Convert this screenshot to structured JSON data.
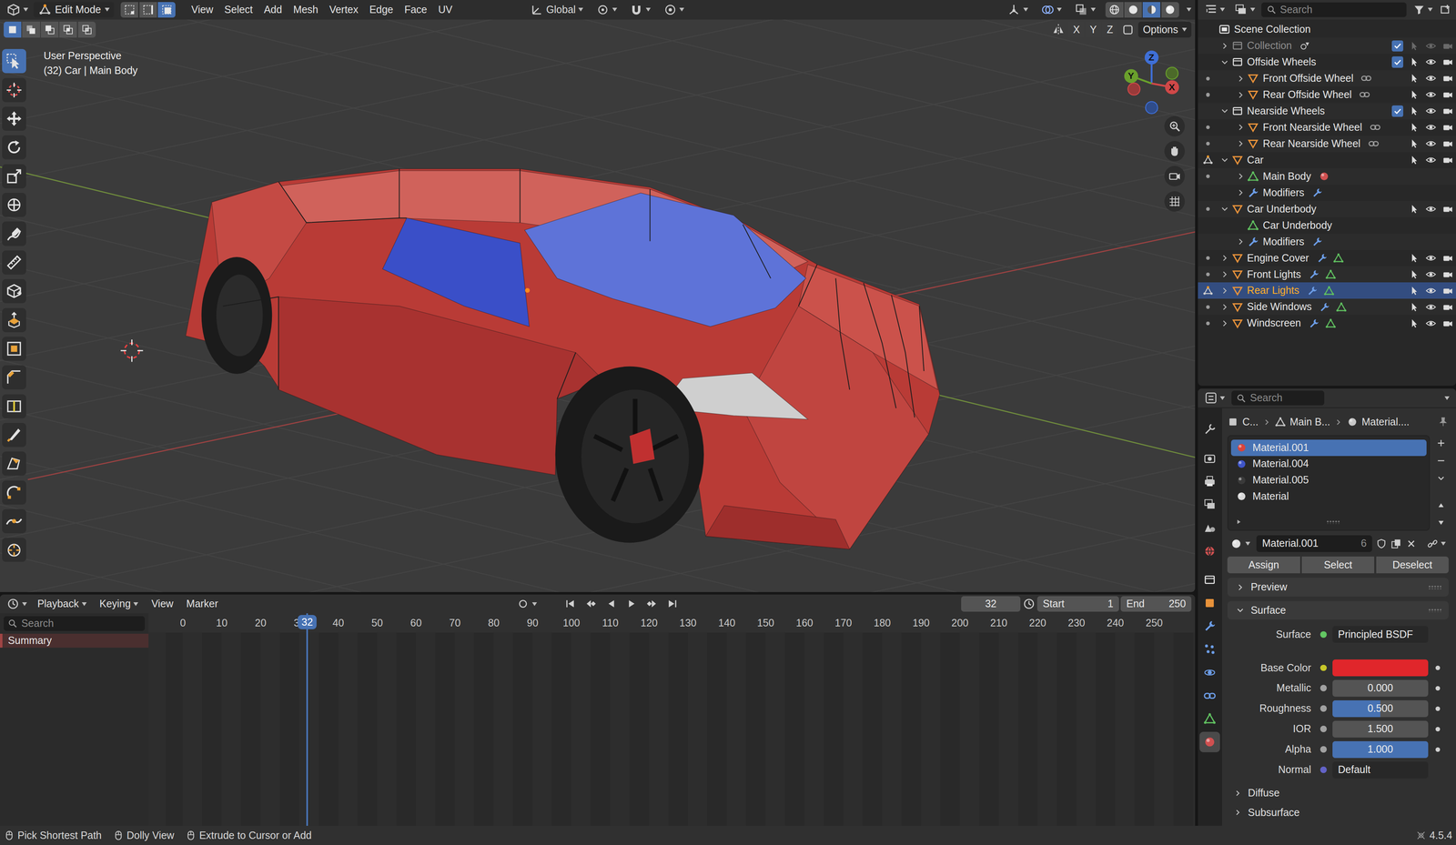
{
  "viewport_header": {
    "mode": "Edit Mode",
    "select_modes": [
      {
        "kind": "vertex",
        "selected": false
      },
      {
        "kind": "edge",
        "selected": false
      },
      {
        "kind": "face",
        "selected": true
      }
    ],
    "menus": [
      "View",
      "Select",
      "Add",
      "Mesh",
      "Vertex",
      "Edge",
      "Face",
      "UV"
    ],
    "orientation": "Global",
    "shading": [
      {
        "kind": "wireframe",
        "selected": false
      },
      {
        "kind": "solid",
        "selected": false
      },
      {
        "kind": "material_shading",
        "selected": true
      },
      {
        "kind": "rendered",
        "selected": false
      }
    ]
  },
  "tool_header": {
    "box_modes": [
      {
        "kind": "box_new",
        "selected": true
      },
      {
        "kind": "box_extend",
        "selected": false
      },
      {
        "kind": "box_subtract",
        "selected": false
      },
      {
        "kind": "box_invert",
        "selected": false
      },
      {
        "kind": "box_intersect",
        "selected": false
      }
    ],
    "mirror_axes": [
      "X",
      "Y",
      "Z"
    ],
    "options": "Options"
  },
  "viewport": {
    "view_name": "User Perspective",
    "object_info": "(32) Car | Main Body",
    "gizmo_axes": [
      "X",
      "Y",
      "Z"
    ]
  },
  "toolbar": [
    {
      "kind": "select",
      "selected": true
    },
    {
      "kind": "cursor",
      "selected": false
    },
    {
      "kind": "move",
      "selected": false
    },
    {
      "kind": "rotate",
      "selected": false
    },
    {
      "kind": "scale",
      "selected": false
    },
    {
      "kind": "transform",
      "selected": false
    },
    {
      "kind": "annotate",
      "selected": false
    },
    {
      "kind": "measure",
      "selected": false
    },
    {
      "kind": "add_cube",
      "selected": false
    },
    {
      "kind": "extrude",
      "selected": false
    },
    {
      "kind": "inset",
      "selected": false
    },
    {
      "kind": "bevel",
      "selected": false
    },
    {
      "kind": "loop_cut",
      "selected": false
    },
    {
      "kind": "knife",
      "selected": false
    },
    {
      "kind": "poly_build",
      "selected": false
    },
    {
      "kind": "spin",
      "selected": false
    },
    {
      "kind": "smooth",
      "selected": false
    },
    {
      "kind": "shrink",
      "selected": false
    }
  ],
  "outliner": {
    "search_placeholder": "Search",
    "rows": [
      {
        "label": "Scene Collection",
        "depth": 0,
        "kind": "scene",
        "arrow": false,
        "expanded": false,
        "selected": false,
        "dimmed": false,
        "gutter": "none",
        "tags": []
      },
      {
        "label": "Collection",
        "depth": 1,
        "kind": "collection",
        "arrow": true,
        "expanded": false,
        "selected": false,
        "dimmed": true,
        "checked": true,
        "gutter": "none",
        "tags": [
          "scene_objects"
        ]
      },
      {
        "label": "Offside Wheels",
        "depth": 1,
        "kind": "collection",
        "arrow": true,
        "expanded": true,
        "selected": false,
        "dimmed": false,
        "checked": true,
        "gutter": "none",
        "tags": []
      },
      {
        "label": "Front Offside Wheel",
        "depth": 2,
        "kind": "object",
        "arrow": true,
        "expanded": false,
        "selected": false,
        "dimmed": false,
        "gutter": "dot",
        "tags": [
          "constraint"
        ]
      },
      {
        "label": "Rear Offside Wheel",
        "depth": 2,
        "kind": "object",
        "arrow": true,
        "expanded": false,
        "selected": false,
        "dimmed": false,
        "gutter": "dot",
        "tags": [
          "constraint"
        ]
      },
      {
        "label": "Nearside Wheels",
        "depth": 1,
        "kind": "collection",
        "arrow": true,
        "expanded": true,
        "selected": false,
        "dimmed": false,
        "checked": true,
        "gutter": "none",
        "tags": []
      },
      {
        "label": "Front Nearside Wheel",
        "depth": 2,
        "kind": "object",
        "arrow": true,
        "expanded": false,
        "selected": false,
        "dimmed": false,
        "gutter": "dot",
        "tags": [
          "constraint"
        ]
      },
      {
        "label": "Rear Nearside Wheel",
        "depth": 2,
        "kind": "object",
        "arrow": true,
        "expanded": false,
        "selected": false,
        "dimmed": false,
        "gutter": "dot",
        "tags": [
          "constraint"
        ]
      },
      {
        "label": "Car",
        "depth": 1,
        "kind": "object",
        "arrow": true,
        "expanded": true,
        "selected": false,
        "dimmed": false,
        "gutter": "edit",
        "tags": []
      },
      {
        "label": "Main Body",
        "depth": 2,
        "kind": "mesh",
        "arrow": true,
        "expanded": false,
        "selected": false,
        "dimmed": false,
        "gutter": "dot",
        "tags": [
          "material"
        ]
      },
      {
        "label": "Modifiers",
        "depth": 2,
        "kind": "modifiers",
        "arrow": true,
        "expanded": false,
        "selected": false,
        "dimmed": false,
        "gutter": "none",
        "tags": [
          "modifier_stack"
        ]
      },
      {
        "label": "Car Underbody",
        "depth": 1,
        "kind": "object",
        "arrow": true,
        "expanded": true,
        "selected": false,
        "dimmed": false,
        "gutter": "dot",
        "tags": []
      },
      {
        "label": "Car Underbody",
        "depth": 2,
        "kind": "mesh",
        "arrow": false,
        "expanded": false,
        "selected": false,
        "dimmed": false,
        "gutter": "none",
        "tags": []
      },
      {
        "label": "Modifiers",
        "depth": 2,
        "kind": "modifiers",
        "arrow": true,
        "expanded": false,
        "selected": false,
        "dimmed": false,
        "gutter": "none",
        "tags": [
          "modifier_stack"
        ]
      },
      {
        "label": "Engine Cover",
        "depth": 1,
        "kind": "object",
        "arrow": true,
        "expanded": false,
        "selected": false,
        "dimmed": false,
        "gutter": "dot",
        "tags": [
          "modifiers",
          "mesh"
        ]
      },
      {
        "label": "Front Lights",
        "depth": 1,
        "kind": "object",
        "arrow": true,
        "expanded": false,
        "selected": false,
        "dimmed": false,
        "gutter": "dot",
        "tags": [
          "modifiers",
          "mesh"
        ]
      },
      {
        "label": "Rear Lights",
        "depth": 1,
        "kind": "object",
        "arrow": true,
        "expanded": false,
        "selected": true,
        "dimmed": false,
        "gutter": "edit",
        "tags": [
          "modifiers",
          "mesh"
        ]
      },
      {
        "label": "Side Windows",
        "depth": 1,
        "kind": "object",
        "arrow": true,
        "expanded": false,
        "selected": false,
        "dimmed": false,
        "gutter": "dot",
        "tags": [
          "modifiers",
          "mesh"
        ]
      },
      {
        "label": "Windscreen",
        "depth": 1,
        "kind": "object",
        "arrow": true,
        "expanded": false,
        "selected": false,
        "dimmed": false,
        "gutter": "dot",
        "tags": [
          "modifiers",
          "mesh"
        ]
      }
    ]
  },
  "properties": {
    "search_placeholder": "Search",
    "tabs": [
      {
        "kind": "tool",
        "selected": false
      },
      {
        "kind": "render",
        "selected": false
      },
      {
        "kind": "output",
        "selected": false
      },
      {
        "kind": "view_layer",
        "selected": false
      },
      {
        "kind": "scene_tab",
        "selected": false
      },
      {
        "kind": "world",
        "selected": false
      },
      {
        "kind": "collection_tab",
        "selected": false
      },
      {
        "kind": "object_tab",
        "selected": false
      },
      {
        "kind": "modifiers",
        "selected": false
      },
      {
        "kind": "particles",
        "selected": false
      },
      {
        "kind": "physics",
        "selected": false
      },
      {
        "kind": "constraint",
        "selected": false
      },
      {
        "kind": "mesh",
        "selected": false
      },
      {
        "kind": "material",
        "selected": true
      }
    ],
    "breadcrumb": [
      "C...",
      "Main B...",
      "Material...."
    ],
    "slots": [
      {
        "name": "Material.001",
        "color": "#d8443c",
        "selected": true
      },
      {
        "name": "Material.004",
        "color": "#3f55c8",
        "selected": false
      },
      {
        "name": "Material.005",
        "color": "#3a3a3a",
        "selected": false
      },
      {
        "name": "Material",
        "color": "#d9d9d9",
        "selected": false
      }
    ],
    "material_name": "Material.001",
    "users": "6",
    "buttons": [
      "Assign",
      "Select",
      "Deselect"
    ],
    "panels": [
      {
        "title": "Preview",
        "expanded": false
      },
      {
        "title": "Surface",
        "expanded": true
      }
    ],
    "fields": [
      {
        "label": "Surface",
        "kind": "shader",
        "value": "Principled BSDF",
        "socket": "#63c763"
      },
      {
        "label": "Base Color",
        "kind": "color",
        "color": "#e0262b",
        "socket": "#c7c729"
      },
      {
        "label": "Metallic",
        "kind": "slider",
        "value": "0.000",
        "level": 0,
        "socket": "#a1a1a1"
      },
      {
        "label": "Roughness",
        "kind": "slider",
        "value": "0.500",
        "level": 0.5,
        "socket": "#a1a1a1"
      },
      {
        "label": "IOR",
        "kind": "number",
        "value": "1.500",
        "socket": "#a1a1a1"
      },
      {
        "label": "Alpha",
        "kind": "slider",
        "value": "1.000",
        "level": 1,
        "socket": "#a1a1a1"
      },
      {
        "label": "Normal",
        "kind": "vector",
        "value": "Default",
        "socket": "#6363c7"
      }
    ],
    "subpanels": [
      {
        "title": "Diffuse",
        "expanded": false
      },
      {
        "title": "Subsurface",
        "expanded": false
      }
    ]
  },
  "timeline": {
    "menus": [
      "Playback",
      "Keying",
      "View",
      "Marker"
    ],
    "current_frame": "32",
    "start_label": "Start",
    "start": "1",
    "end_label": "End",
    "end": "250",
    "ticks": [
      "0",
      "10",
      "20",
      "30",
      "40",
      "50",
      "60",
      "70",
      "80",
      "90",
      "100",
      "110",
      "120",
      "130",
      "140",
      "150",
      "160",
      "170",
      "180",
      "190",
      "200",
      "210",
      "220",
      "230",
      "240",
      "250"
    ],
    "playhead": "32",
    "search_placeholder": "Search",
    "channels": [
      "Summary"
    ]
  },
  "status_bar": {
    "hints": [
      "Pick Shortest Path",
      "Dolly View",
      "Extrude to Cursor or Add"
    ],
    "version": "4.5.4"
  }
}
